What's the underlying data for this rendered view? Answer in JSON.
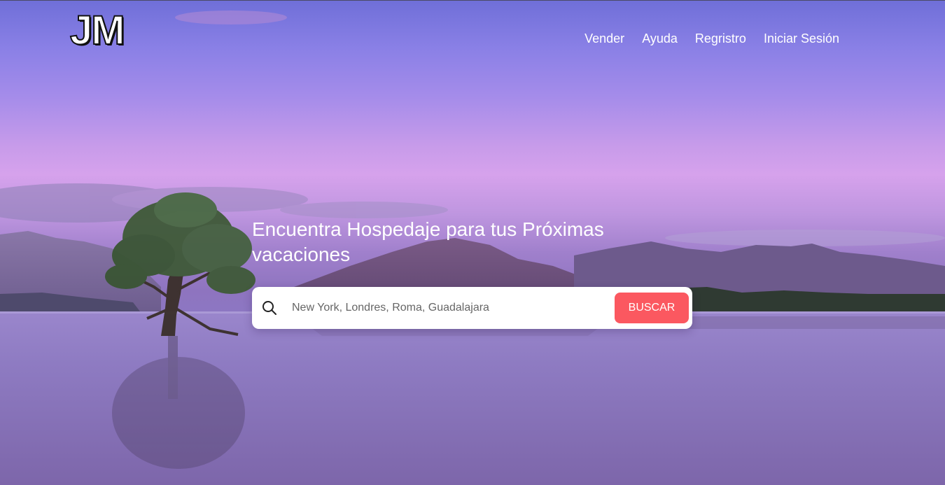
{
  "brand": {
    "logo_text": "JM"
  },
  "nav": {
    "items": [
      {
        "label": "Vender"
      },
      {
        "label": "Ayuda"
      },
      {
        "label": "Regristro"
      },
      {
        "label": "Iniciar Sesión"
      }
    ]
  },
  "hero": {
    "headline": "Encuentra Hospedaje para tus Próximas vacaciones",
    "background_image": "lake-with-lone-tree-at-dusk"
  },
  "search": {
    "placeholder": "New York, Londres, Roma, Guadalajara",
    "value": "",
    "icon": "search-icon",
    "button_label": "BUSCAR"
  },
  "colors": {
    "accent": "#fb5860",
    "text_light": "#ffffff",
    "sky_top": "#6f6fd8",
    "sky_glow": "#d6a2ec",
    "water": "#8670b8"
  }
}
